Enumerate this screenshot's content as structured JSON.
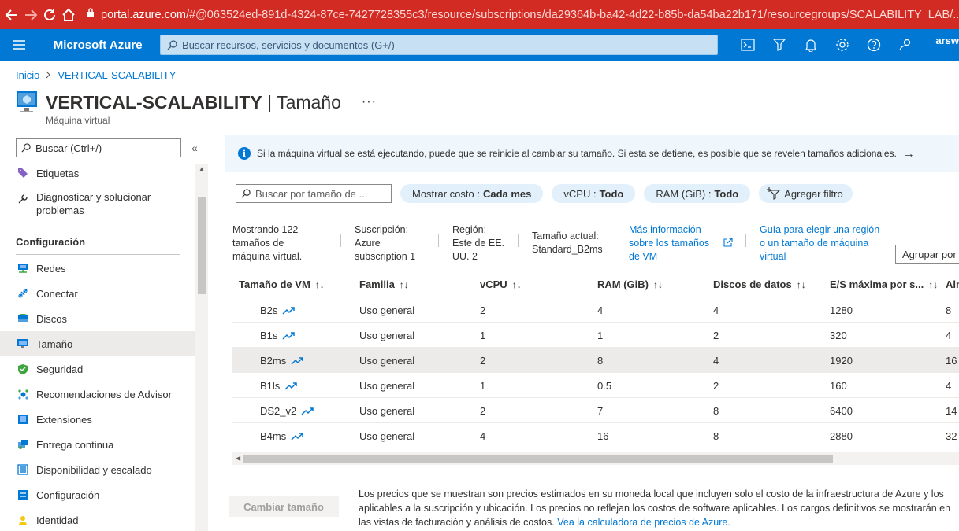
{
  "browser": {
    "url_host": "portal.azure.com",
    "url_path": "/#@063524ed-891d-4324-87ce-7427728355c3/resource/subscriptions/da29364b-ba42-4d22-b85b-da54ba22b171/resourcegroups/SCALABILITY_LAB/..."
  },
  "header": {
    "brand": "Microsoft Azure",
    "search_placeholder": "Buscar recursos, servicios y documentos (G+/)",
    "user": "arsw"
  },
  "breadcrumb": {
    "home": "Inicio",
    "current": "VERTICAL-SCALABILITY"
  },
  "page": {
    "title": "VERTICAL-SCALABILITY",
    "separator": "|",
    "section": "Tamaño",
    "more": "···",
    "resource_type": "Máquina virtual"
  },
  "sidebar": {
    "search_placeholder": "Buscar (Ctrl+/)",
    "collapse": "«",
    "section_title": "Configuración",
    "items": [
      {
        "label": "Etiquetas",
        "icon": "tag-icon"
      },
      {
        "label": "Diagnosticar y solucionar",
        "label2": "problemas",
        "icon": "wrench-icon"
      },
      {
        "label": "Redes",
        "icon": "network-icon"
      },
      {
        "label": "Conectar",
        "icon": "connect-icon"
      },
      {
        "label": "Discos",
        "icon": "disks-icon"
      },
      {
        "label": "Tamaño",
        "icon": "monitor-icon"
      },
      {
        "label": "Seguridad",
        "icon": "shield-icon"
      },
      {
        "label": "Recomendaciones de Advisor",
        "icon": "advisor-icon"
      },
      {
        "label": "Extensiones",
        "icon": "extensions-icon"
      },
      {
        "label": "Entrega continua",
        "icon": "delivery-icon"
      },
      {
        "label": "Disponibilidad y escalado",
        "icon": "availability-icon"
      },
      {
        "label": "Configuración",
        "icon": "config-icon"
      },
      {
        "label": "Identidad",
        "icon": "identity-icon"
      }
    ]
  },
  "info_bar": {
    "text": "Si la máquina virtual se está ejecutando, puede que se reinicie al cambiar su tamaño. Si esta se detiene, es posible que se revelen tamaños adicionales.",
    "arrow": "→"
  },
  "filters": {
    "search_placeholder": "Buscar por tamaño de ...",
    "cost_label": "Mostrar costo :",
    "cost_value": "Cada mes",
    "vcpu_label": "vCPU :",
    "vcpu_value": "Todo",
    "ram_label": "RAM (GiB) :",
    "ram_value": "Todo",
    "add_filter": "Agregar filtro"
  },
  "summary": {
    "count_l1": "Mostrando 122",
    "count_l2": "tamaños de",
    "count_l3": "máquina virtual.",
    "sub_l1": "Suscripción:",
    "sub_l2": "Azure",
    "sub_l3": "subscription 1",
    "reg_l1": "Región:",
    "reg_l2": "Este de EE.",
    "reg_l3": "UU. 2",
    "cur_l1": "Tamaño actual:",
    "cur_l2": "Standard_B2ms",
    "more_l1": "Más información",
    "more_l2": "sobre los tamaños",
    "more_l3": "de VM",
    "guide_l1": "Guía para elegir una región",
    "guide_l2": "o un tamaño de máquina",
    "guide_l3": "virtual",
    "group_by": "Agrupar por"
  },
  "table": {
    "headers": [
      "Tamaño de VM",
      "Familia",
      "vCPU",
      "RAM (GiB)",
      "Discos de datos",
      "E/S máxima por s...",
      "Alm"
    ],
    "sort_icon": "↑↓",
    "rows": [
      {
        "name": "B2s",
        "family": "Uso general",
        "vcpu": "2",
        "ram": "4",
        "disks": "4",
        "iops": "1280",
        "storage": "8"
      },
      {
        "name": "B1s",
        "family": "Uso general",
        "vcpu": "1",
        "ram": "1",
        "disks": "2",
        "iops": "320",
        "storage": "4"
      },
      {
        "name": "B2ms",
        "family": "Uso general",
        "vcpu": "2",
        "ram": "8",
        "disks": "4",
        "iops": "1920",
        "storage": "16"
      },
      {
        "name": "B1ls",
        "family": "Uso general",
        "vcpu": "1",
        "ram": "0.5",
        "disks": "2",
        "iops": "160",
        "storage": "4"
      },
      {
        "name": "DS2_v2",
        "family": "Uso general",
        "vcpu": "2",
        "ram": "7",
        "disks": "8",
        "iops": "6400",
        "storage": "14"
      },
      {
        "name": "B4ms",
        "family": "Uso general",
        "vcpu": "4",
        "ram": "16",
        "disks": "8",
        "iops": "2880",
        "storage": "32"
      }
    ],
    "selected_row": 2
  },
  "footer": {
    "resize_button": "Cambiar tamaño",
    "line1": "Los precios que se muestran son precios estimados en su moneda local que incluyen solo el costo de la infraestructura de Azure y los",
    "line2": "aplicables a la suscripción y ubicación. Los precios no reflejan los costos de software aplicables. Los cargos definitivos se mostrarán en",
    "line3": "las vistas de facturación y análisis de costos.",
    "link": "Vea la calculadora de precios de Azure."
  },
  "colors": {
    "browser_bar": "#d22b24",
    "azure_blue": "#0078d4",
    "info_bg": "#eff6fc",
    "pill_bg": "#e1f0fb"
  }
}
